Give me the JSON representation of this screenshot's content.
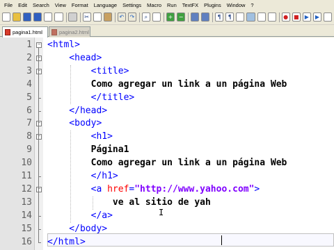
{
  "menubar": {
    "items": [
      "File",
      "Edit",
      "Search",
      "View",
      "Format",
      "Language",
      "Settings",
      "Macro",
      "Run",
      "TextFX",
      "Plugins",
      "Window",
      "?"
    ]
  },
  "toolbar": {
    "icons": [
      "new-file-icon",
      "open-file-icon",
      "save-icon",
      "save-all-icon",
      "close-icon",
      "close-all-icon",
      "print-icon",
      "cut-icon",
      "copy-icon",
      "paste-icon",
      "undo-icon",
      "redo-icon",
      "find-icon",
      "replace-icon",
      "zoom-in-icon",
      "zoom-out-icon",
      "sync-vertical-icon",
      "sync-horizontal-icon",
      "word-wrap-icon",
      "show-all-chars-icon",
      "indent-guide-icon",
      "user-lang-icon",
      "doc-map-icon",
      "function-list-icon",
      "record-macro-icon",
      "stop-record-icon",
      "play-macro-icon",
      "play-multiple-icon",
      "save-macro-icon"
    ]
  },
  "tabs": [
    {
      "label": "pagina1.html",
      "active": true
    },
    {
      "label": "pagina2.html",
      "active": false
    }
  ],
  "editor": {
    "lines": [
      {
        "num": "1",
        "segments": [
          {
            "cls": "tag",
            "text": "<html>"
          }
        ]
      },
      {
        "num": "2",
        "segments": [
          {
            "cls": "tag",
            "text": "    <head>"
          }
        ]
      },
      {
        "num": "3",
        "segments": [
          {
            "cls": "tag",
            "text": "        <title>"
          }
        ]
      },
      {
        "num": "4",
        "segments": [
          {
            "cls": "txt",
            "text": "        Como agregar un link a un página Web"
          }
        ]
      },
      {
        "num": "5",
        "segments": [
          {
            "cls": "tag",
            "text": "        </title>"
          }
        ]
      },
      {
        "num": "6",
        "segments": [
          {
            "cls": "tag",
            "text": "    </head>"
          }
        ]
      },
      {
        "num": "7",
        "segments": [
          {
            "cls": "tag",
            "text": "    <body>"
          }
        ]
      },
      {
        "num": "8",
        "segments": [
          {
            "cls": "tag",
            "text": "        <h1>"
          }
        ]
      },
      {
        "num": "9",
        "segments": [
          {
            "cls": "txt",
            "text": "        Página1"
          }
        ]
      },
      {
        "num": "10",
        "segments": [
          {
            "cls": "txt",
            "text": "        Como agregar un link a un página Web"
          }
        ]
      },
      {
        "num": "11",
        "segments": [
          {
            "cls": "tag",
            "text": "        </h1>"
          }
        ]
      },
      {
        "num": "12",
        "segments": [
          {
            "cls": "tag",
            "text": "        <a "
          },
          {
            "cls": "attr",
            "text": "href"
          },
          {
            "cls": "tag",
            "text": "="
          },
          {
            "cls": "val",
            "text": "\"http://www.yahoo.com\""
          },
          {
            "cls": "tag",
            "text": ">"
          }
        ]
      },
      {
        "num": "13",
        "segments": [
          {
            "cls": "txt",
            "text": "            ve al sitio de yah"
          }
        ]
      },
      {
        "num": "14",
        "segments": [
          {
            "cls": "tag",
            "text": "        </a>"
          }
        ]
      },
      {
        "num": "15",
        "segments": [
          {
            "cls": "tag",
            "text": "    </body>"
          }
        ]
      },
      {
        "num": "16",
        "segments": [
          {
            "cls": "tag",
            "text": "</html>"
          }
        ]
      }
    ]
  },
  "colors": {
    "tag": "#0000ff",
    "attr": "#ff0000",
    "value": "#8000ff",
    "text": "#000000",
    "gutter_bg": "#e4e4e4",
    "chrome_bg": "#ece9d8"
  }
}
